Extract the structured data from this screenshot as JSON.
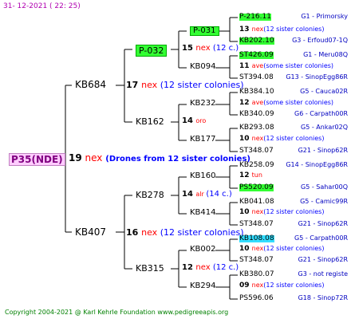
{
  "date": "31- 12-2021 ( 22: 25)",
  "root": "P35(NDE)",
  "gen1": {
    "count": "19",
    "nex": "nex",
    "note": "(Drones from 12 sister colonies)"
  },
  "gen2": [
    {
      "id": "KB684",
      "count": "17",
      "nex": "nex",
      "note": "(12 sister colonies)"
    },
    {
      "id": "KB407",
      "count": "16",
      "nex": "nex",
      "note": "(12 sister colonies)"
    }
  ],
  "gen3": [
    {
      "id": "P-032",
      "count": "15",
      "nex": "nex",
      "note": "(12 c.)"
    },
    {
      "id": "KB162",
      "count": "14",
      "nex": "oro",
      "note": ""
    },
    {
      "id": "KB278",
      "count": "14",
      "nex": "alr",
      "note": "(14 c.)"
    },
    {
      "id": "KB315",
      "count": "12",
      "nex": "nex",
      "note": "(12 c.)"
    }
  ],
  "gen4": [
    {
      "id": "P-031",
      "count": "13",
      "nex": "nex",
      "note": "(12 sister colonies)"
    },
    {
      "id": "KB094",
      "count": "11",
      "nex": "ave",
      "note": "(some sister colonies)"
    },
    {
      "id": "KB232",
      "count": "12",
      "nex": "ave",
      "note": "(some sister colonies)"
    },
    {
      "id": "KB177",
      "count": "10",
      "nex": "nex",
      "note": "(12 sister colonies)"
    },
    {
      "id": "KB160",
      "count": "12",
      "nex": "tun",
      "note": ""
    },
    {
      "id": "KB414",
      "count": "10",
      "nex": "nex",
      "note": "(12 sister colonies)"
    },
    {
      "id": "KB002",
      "count": "10",
      "nex": "nex",
      "note": "(12 sister colonies)"
    },
    {
      "id": "KB294",
      "count": "09",
      "nex": "nex",
      "note": "(12 sister colonies)"
    }
  ],
  "gen5": [
    {
      "id": "P-216.11",
      "g": "G1 - Primorsky"
    },
    {
      "id": "KB202.10",
      "g": "G3 - Erfoud07-1Q"
    },
    {
      "id": "ST426.09",
      "g": "G1 - Meru08Q"
    },
    {
      "id": "ST394.08",
      "g": "G13 - SinopEgg86R"
    },
    {
      "id": "KB384.10",
      "g": "G5 - Cauca02R"
    },
    {
      "id": "KB340.09",
      "g": "G6 - Carpath00R"
    },
    {
      "id": "KB293.08",
      "g": "G5 - Ankar02Q"
    },
    {
      "id": "ST348.07",
      "g": "G21 - Sinop62R"
    },
    {
      "id": "KB258.09",
      "g": "G14 - SinopEgg86R"
    },
    {
      "id": "PS520.09",
      "g": "G5 - Sahar00Q"
    },
    {
      "id": "KB041.08",
      "g": "G5 - Camic99R"
    },
    {
      "id": "ST348.07",
      "g": "G21 - Sinop62R"
    },
    {
      "id": "KB108.08",
      "g": "G5 - Carpath00R"
    },
    {
      "id": "ST348.07",
      "g": "G21 - Sinop62R"
    },
    {
      "id": "KB380.07",
      "g": "G3 - not registe"
    },
    {
      "id": "PS596.06",
      "g": "G18 - Sinop72R"
    }
  ],
  "footer": "Copyright 2004-2021 @ Karl Kehrle Foundation   www.pedigreeapis.org"
}
